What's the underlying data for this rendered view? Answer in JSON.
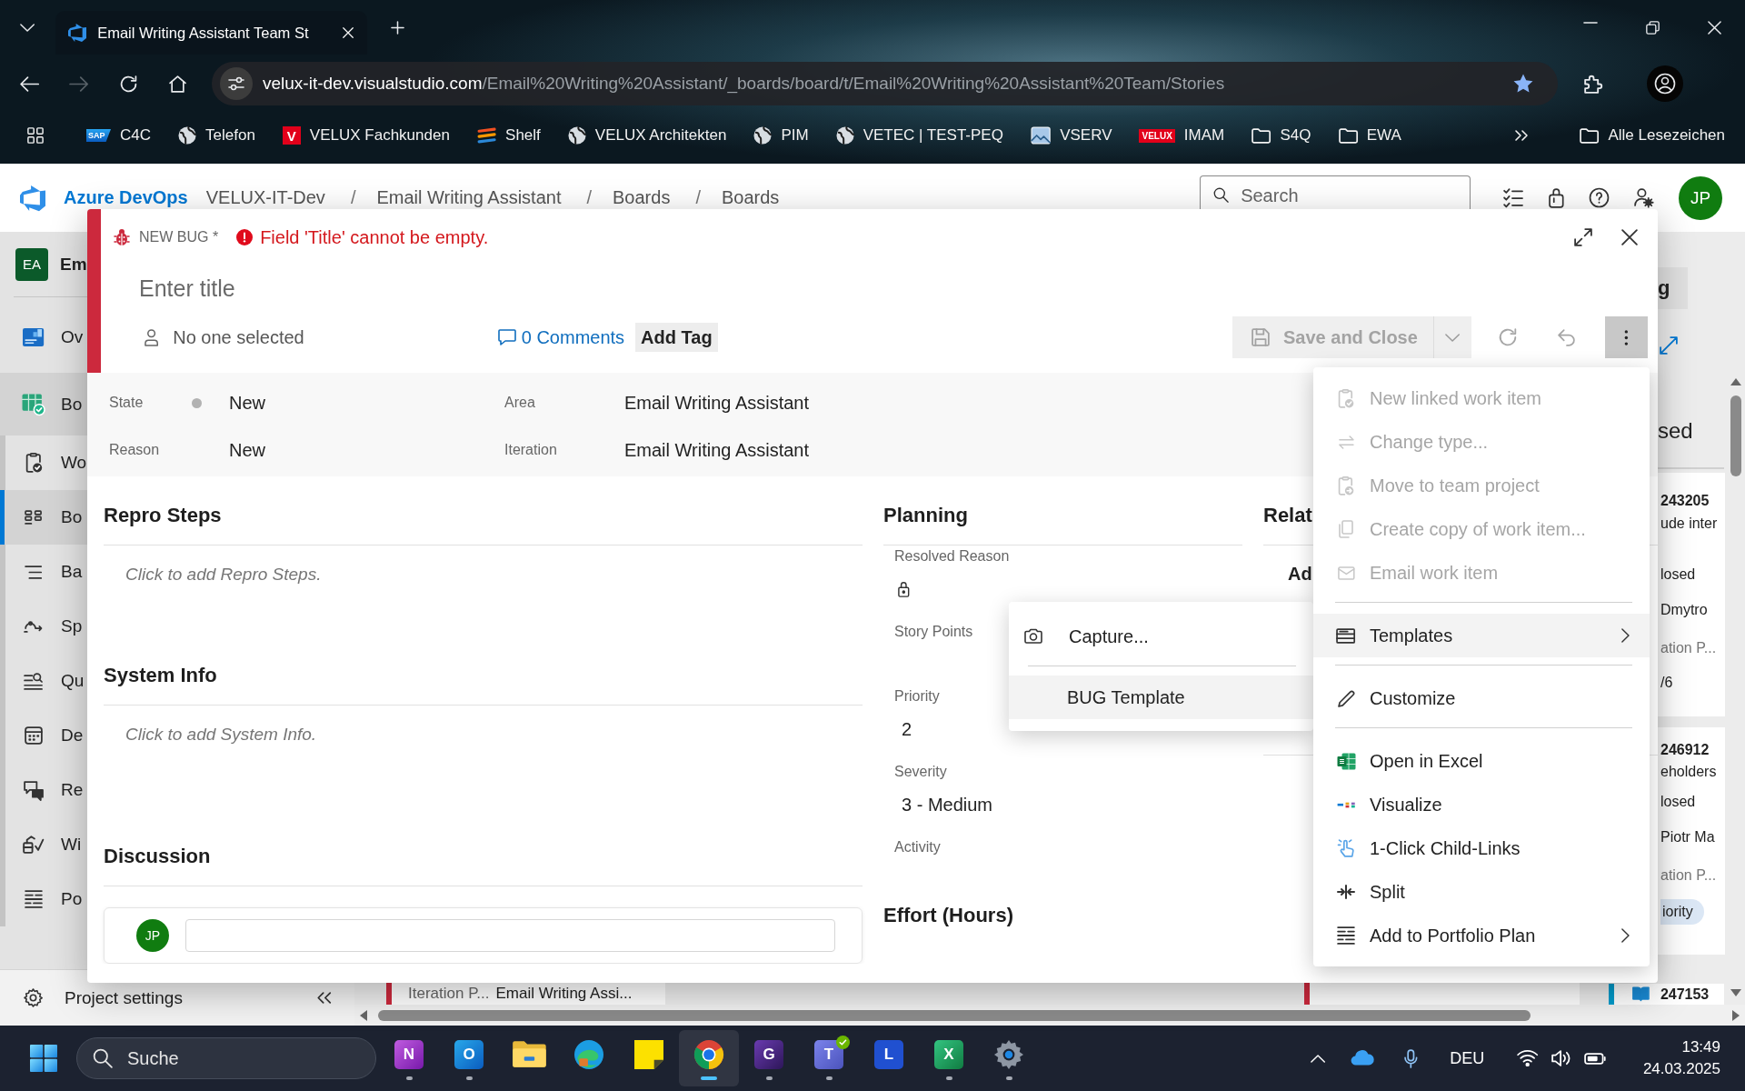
{
  "browser": {
    "tab_title": "Email Writing Assistant Team St",
    "forward_disabled": true,
    "url_host": "velux-it-dev.visualstudio.com",
    "url_path": "/Email%20Writing%20Assistant/_boards/board/t/Email%20Writing%20Assistant%20Team/Stories",
    "bookmarks": [
      {
        "label": "C4C",
        "kind": "sap",
        "badge": "SAP"
      },
      {
        "label": "Telefon",
        "kind": "globe"
      },
      {
        "label": "VELUX Fachkunden",
        "kind": "velux",
        "badge": "V"
      },
      {
        "label": "Shelf",
        "kind": "stripes"
      },
      {
        "label": "VELUX Architekten",
        "kind": "globe"
      },
      {
        "label": "PIM",
        "kind": "globe"
      },
      {
        "label": "VETEC | TEST-PEQ",
        "kind": "globe"
      },
      {
        "label": "VSERV",
        "kind": "image"
      },
      {
        "label": "IMAM",
        "kind": "velux-wide",
        "badge": "VELUX"
      },
      {
        "label": "S4Q",
        "kind": "folder"
      },
      {
        "label": "EWA",
        "kind": "folder"
      }
    ],
    "all_bookmarks": "Alle Lesezeichen"
  },
  "header": {
    "product": "Azure DevOps",
    "breadcrumb": [
      {
        "label": "VELUX-IT-Dev"
      },
      {
        "separator": "/",
        "label": "Email Writing Assistant"
      },
      {
        "separator": "/",
        "label": "Boards"
      },
      {
        "separator": "/",
        "label": "Boards"
      }
    ],
    "search": {
      "placeholder": "Search"
    },
    "avatar": "JP"
  },
  "sidebar": {
    "project_avatar": "EA",
    "project": "Em",
    "items": [
      {
        "label": "Ov",
        "kind": "top",
        "selected": false
      },
      {
        "label": "Bo",
        "kind": "hub",
        "selected": false
      },
      {
        "label": "Wo",
        "kind": "sub",
        "selected": false
      },
      {
        "label": "Bo",
        "kind": "sub",
        "selected": true
      },
      {
        "label": "Ba",
        "kind": "sub",
        "selected": false
      },
      {
        "label": "Sp",
        "kind": "sub",
        "selected": false
      },
      {
        "label": "Qu",
        "kind": "sub",
        "selected": false
      },
      {
        "label": "De",
        "kind": "sub",
        "selected": false
      },
      {
        "label": "Re",
        "kind": "sub",
        "selected": false
      },
      {
        "label": "Wi",
        "kind": "sub",
        "selected": false
      },
      {
        "label": "Po",
        "kind": "sub",
        "selected": false
      }
    ],
    "settings": "Project settings"
  },
  "board": {
    "button": "g",
    "column": "sed",
    "cards": [
      {
        "id": "243205",
        "title": "ude inter",
        "state": "losed",
        "assignee": "Dmytro",
        "field": "ation P...",
        "value": "/6"
      },
      {
        "id": "246912",
        "title": "eholders",
        "state": "losed",
        "assignee": "Piotr Ma",
        "field": "ation P...",
        "tag": "iority"
      }
    ],
    "story": {
      "id": "247153"
    },
    "bug_card": {
      "field": "Iteration P...",
      "value": "Email Writing Assi..."
    }
  },
  "dialog": {
    "type": "NEW BUG *",
    "error": "Field 'Title' cannot be empty.",
    "title": {
      "placeholder": "Enter title"
    },
    "assignee": "No one selected",
    "comments": "0 Comments",
    "add_tag": "Add Tag",
    "save": {
      "label": "Save and Close",
      "disabled": true
    },
    "more_expanded": true,
    "field_columns": [
      [
        {
          "label": "State",
          "kind": "state",
          "value": "New"
        },
        {
          "label": "Reason",
          "kind": "text",
          "value": "New"
        }
      ],
      [
        {
          "label": "Area",
          "kind": "text",
          "value": "Email Writing Assistant"
        },
        {
          "label": "Iteration",
          "kind": "text",
          "value": "Email Writing Assistant"
        }
      ]
    ],
    "sections": [
      {
        "title": "Repro Steps",
        "placeholder": "Click to add Repro Steps."
      },
      {
        "title": "System Info",
        "placeholder": "Click to add System Info."
      },
      {
        "title": "Discussion",
        "avatar": "JP"
      }
    ],
    "planning": {
      "title": "Planning",
      "fields": [
        {
          "label": "Resolved Reason",
          "kind": "locked"
        },
        {
          "label": "Story Points",
          "kind": "empty"
        },
        {
          "label": "Priority",
          "kind": "text",
          "value": "2"
        },
        {
          "label": "Severity",
          "kind": "text",
          "value": "3 - Medium"
        },
        {
          "label": "Activity",
          "kind": "empty"
        }
      ]
    },
    "effort": "Effort (Hours)",
    "related": {
      "title": "Relat",
      "link": "Ad"
    }
  },
  "menu": {
    "groups": [
      [
        {
          "label": "New linked work item",
          "disabled": true,
          "selected": false,
          "submenu": false
        },
        {
          "label": "Change type...",
          "disabled": true,
          "selected": false,
          "submenu": false
        },
        {
          "label": "Move to team project",
          "disabled": true,
          "selected": false,
          "submenu": false
        },
        {
          "label": "Create copy of work item...",
          "disabled": true,
          "selected": false,
          "submenu": false
        },
        {
          "label": "Email work item",
          "disabled": true,
          "selected": false,
          "submenu": false
        }
      ],
      [
        {
          "label": "Templates",
          "disabled": false,
          "selected": true,
          "submenu": true
        }
      ],
      [
        {
          "label": "Customize",
          "disabled": false,
          "selected": false,
          "submenu": false
        }
      ],
      [
        {
          "label": "Open in Excel",
          "disabled": false,
          "selected": false,
          "submenu": false
        },
        {
          "label": "Visualize",
          "disabled": false,
          "selected": false,
          "submenu": false
        },
        {
          "label": "1-Click Child-Links",
          "disabled": false,
          "selected": false,
          "submenu": false
        },
        {
          "label": "Split",
          "disabled": false,
          "selected": false,
          "submenu": false
        },
        {
          "label": "Add to Portfolio Plan",
          "disabled": false,
          "selected": false,
          "submenu": true
        }
      ]
    ]
  },
  "submenu": {
    "groups": [
      [
        {
          "label": "Capture...",
          "selected": false
        }
      ],
      [
        {
          "label": "BUG Template",
          "selected": true
        }
      ]
    ]
  },
  "taskbar": {
    "search": {
      "placeholder": "Suche"
    },
    "apps": [
      {
        "kind": "notebook",
        "letter": "N",
        "running": true,
        "selected": false
      },
      {
        "kind": "mail",
        "letter": "O",
        "running": true,
        "selected": false
      },
      {
        "kind": "folder",
        "running": false,
        "selected": false
      },
      {
        "kind": "edge",
        "running": false,
        "selected": false
      },
      {
        "kind": "notes",
        "running": false,
        "selected": false
      },
      {
        "kind": "chrome",
        "running": true,
        "selected": true
      },
      {
        "kind": "gtile",
        "letter": "G",
        "running": true,
        "selected": false
      },
      {
        "kind": "chat",
        "letter": "T",
        "running": true,
        "selected": false
      },
      {
        "kind": "ltile",
        "letter": "L",
        "running": false,
        "selected": false
      },
      {
        "kind": "sheet",
        "letter": "X",
        "running": true,
        "selected": false
      },
      {
        "kind": "settings",
        "running": true,
        "selected": false
      }
    ],
    "language": "DEU",
    "time": "13:49",
    "date": "24.03.2025"
  }
}
